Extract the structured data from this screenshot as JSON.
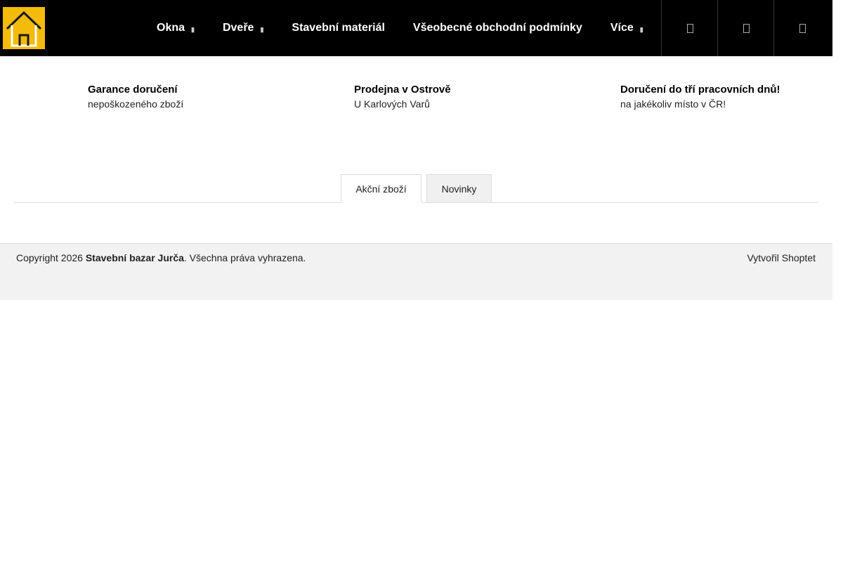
{
  "header": {
    "logo_icon": "house-icon",
    "logo_color": "#f5bb0b",
    "nav": [
      {
        "label": "Okna",
        "has_dropdown": true
      },
      {
        "label": "Dveře",
        "has_dropdown": true
      },
      {
        "label": "Stavební materiál",
        "has_dropdown": false
      },
      {
        "label": "Všeobecné obchodní podmínky",
        "has_dropdown": false
      },
      {
        "label": "Více",
        "has_dropdown": true
      }
    ],
    "icons": [
      "search-icon",
      "user-icon",
      "cart-icon"
    ]
  },
  "benefits": [
    {
      "title": "Garance doručení",
      "subtitle": "nepoškozeného zboží"
    },
    {
      "title": "Prodejna v Ostrově",
      "subtitle": "U Karlových Varů"
    },
    {
      "title": "Doručení do tří pracovních dnů!",
      "subtitle": "na jakékoliv místo v ČR!"
    }
  ],
  "tabs": [
    {
      "label": "Akční zboží",
      "active": true
    },
    {
      "label": "Novinky",
      "active": false
    }
  ],
  "footer": {
    "copyright_prefix": "Copyright 2026",
    "shop_name": "Stavební bazar Jurča",
    "copyright_suffix": ". Všechna práva vyhrazena.",
    "created_by": "Vytvořil Shoptet"
  }
}
